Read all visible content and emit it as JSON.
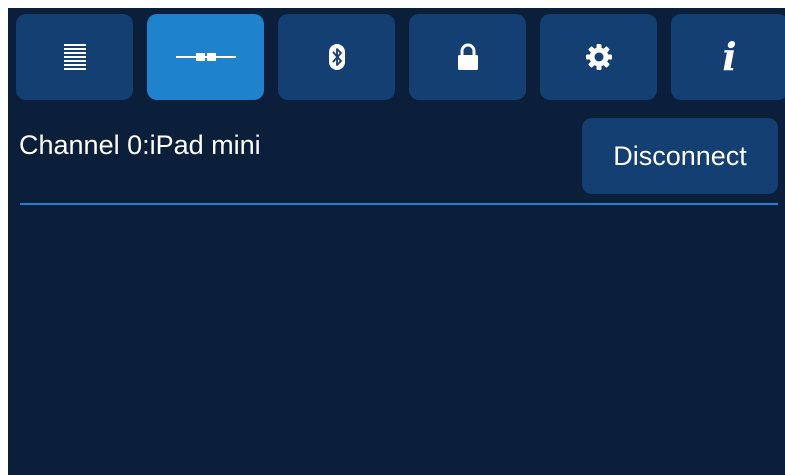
{
  "toolbar": {
    "tabs": [
      {
        "icon": "list-icon",
        "active": false
      },
      {
        "icon": "connection-icon",
        "active": true
      },
      {
        "icon": "bluetooth-icon",
        "active": false
      },
      {
        "icon": "lock-icon",
        "active": false
      },
      {
        "icon": "gear-icon",
        "active": false
      },
      {
        "icon": "info-icon",
        "active": false,
        "glyph": "i"
      }
    ]
  },
  "channel": {
    "label": "Channel 0:iPad mini"
  },
  "actions": {
    "disconnect_label": "Disconnect"
  },
  "colors": {
    "background": "#0b1e3a",
    "tab": "#133f73",
    "tab_active": "#1f82cc",
    "divider": "#1f82cc",
    "text": "#ffffff"
  }
}
